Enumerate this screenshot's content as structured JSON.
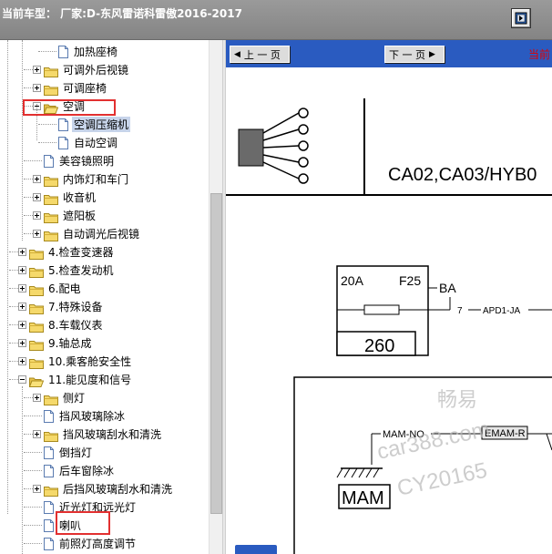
{
  "window": {
    "title": "当前车型：  厂家:D-东风雷诺科雷傲2016-2017"
  },
  "tree": {
    "items": [
      {
        "label": "加热座椅",
        "kind": "doc"
      },
      {
        "label": "可调外后视镜",
        "kind": "folder-collapsed"
      },
      {
        "label": "可调座椅",
        "kind": "folder-collapsed"
      },
      {
        "label": "空调",
        "kind": "folder-expanded"
      },
      {
        "label": "空调压缩机",
        "kind": "doc",
        "selected": true
      },
      {
        "label": "自动空调",
        "kind": "doc"
      },
      {
        "label": "美容镜照明",
        "kind": "doc"
      },
      {
        "label": "内饰灯和车门",
        "kind": "folder-collapsed"
      },
      {
        "label": "收音机",
        "kind": "folder-collapsed"
      },
      {
        "label": "遮阳板",
        "kind": "folder-collapsed"
      },
      {
        "label": "自动调光后视镜",
        "kind": "folder-collapsed"
      },
      {
        "label": "4.检查变速器",
        "kind": "folder-collapsed"
      },
      {
        "label": "5.检查发动机",
        "kind": "folder-collapsed"
      },
      {
        "label": "6.配电",
        "kind": "folder-collapsed"
      },
      {
        "label": "7.特殊设备",
        "kind": "folder-collapsed"
      },
      {
        "label": "8.车载仪表",
        "kind": "folder-collapsed"
      },
      {
        "label": "9.轴总成",
        "kind": "folder-collapsed"
      },
      {
        "label": "10.乘客舱安全性",
        "kind": "folder-collapsed"
      },
      {
        "label": "11.能见度和信号",
        "kind": "folder-expanded"
      },
      {
        "label": "侧灯",
        "kind": "folder-collapsed"
      },
      {
        "label": "挡风玻璃除冰",
        "kind": "doc"
      },
      {
        "label": "挡风玻璃刮水和清洗",
        "kind": "folder-collapsed"
      },
      {
        "label": "倒挡灯",
        "kind": "doc"
      },
      {
        "label": "后车窗除冰",
        "kind": "doc"
      },
      {
        "label": "后挡风玻璃刮水和清洗",
        "kind": "folder-collapsed"
      },
      {
        "label": "近光灯和远光灯",
        "kind": "doc"
      },
      {
        "label": "喇叭",
        "kind": "doc"
      },
      {
        "label": "前照灯高度调节",
        "kind": "doc"
      }
    ]
  },
  "toolbar": {
    "prev_label": "上 一 页",
    "next_label": "下 一 页",
    "current_label": "当前"
  },
  "diagram": {
    "header_code": "CA02,CA03/HYB0",
    "fuse_rating": "20A",
    "fuse_id": "F25",
    "fuse_box_number": "260",
    "line_ba": "BA",
    "pin_number": "7",
    "wire_apd": "APD1-JA",
    "wire_mam_no": "MAM-NO",
    "connector_emam": "EMAM-R",
    "ground_label": "MAM"
  },
  "watermark": {
    "line1": "畅易",
    "line2": "car388.com",
    "line3": "CY20165"
  },
  "colors": {
    "toolbar_blue": "#2a5bc0",
    "highlight_red": "#e23030",
    "selection": "#c7d4ea",
    "folder_yellow": "#f5d96b"
  }
}
